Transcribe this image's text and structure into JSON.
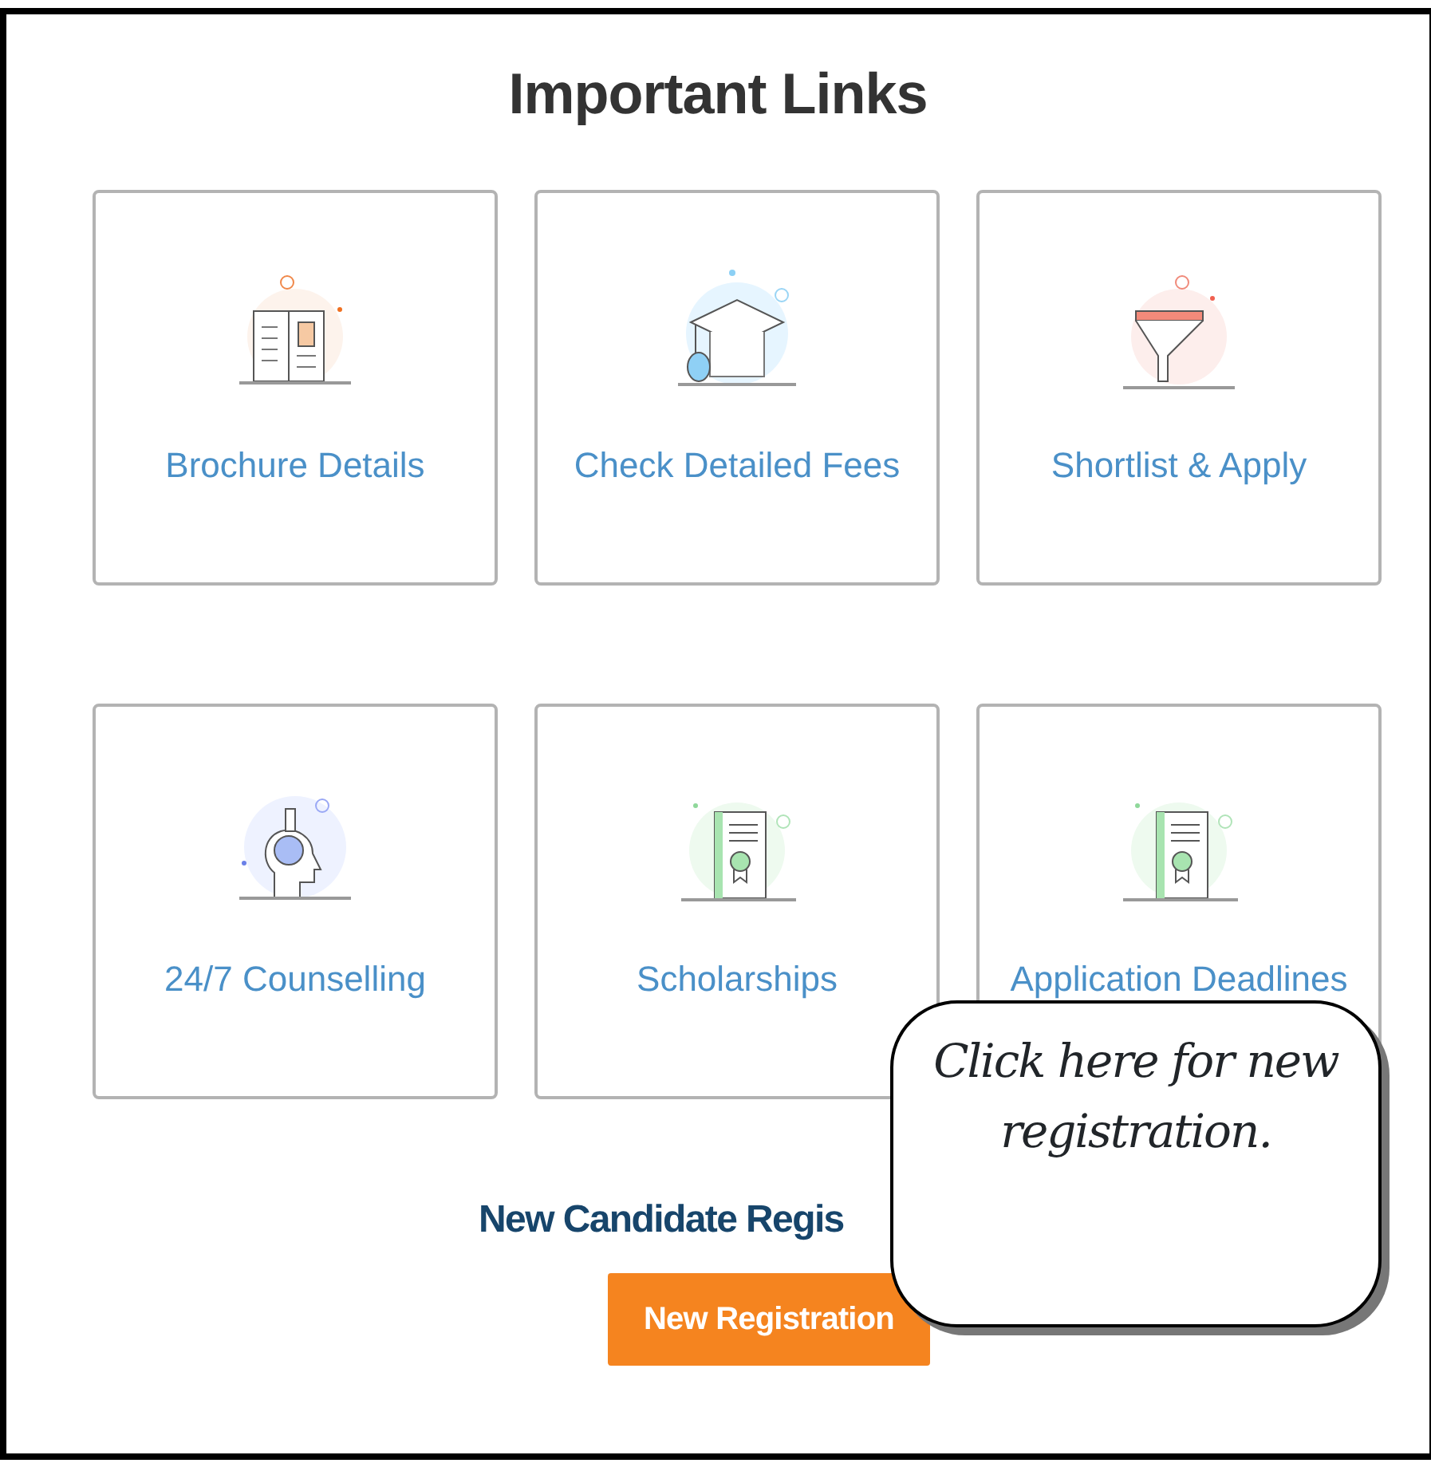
{
  "title": "Important Links",
  "links": [
    {
      "label": "Brochure Details",
      "kind": "book"
    },
    {
      "label": "Check Detailed Fees",
      "kind": "cap"
    },
    {
      "label": "Shortlist & Apply",
      "kind": "funnel"
    },
    {
      "label": "24/7 Counselling",
      "kind": "head"
    },
    {
      "label": "Scholarships",
      "kind": "certificate"
    },
    {
      "label": "Application Deadlines",
      "kind": "certificate"
    }
  ],
  "registration": {
    "heading": "New Candidate Regis",
    "button": "New Registration"
  },
  "callout": {
    "text": "Click here for new registration."
  }
}
